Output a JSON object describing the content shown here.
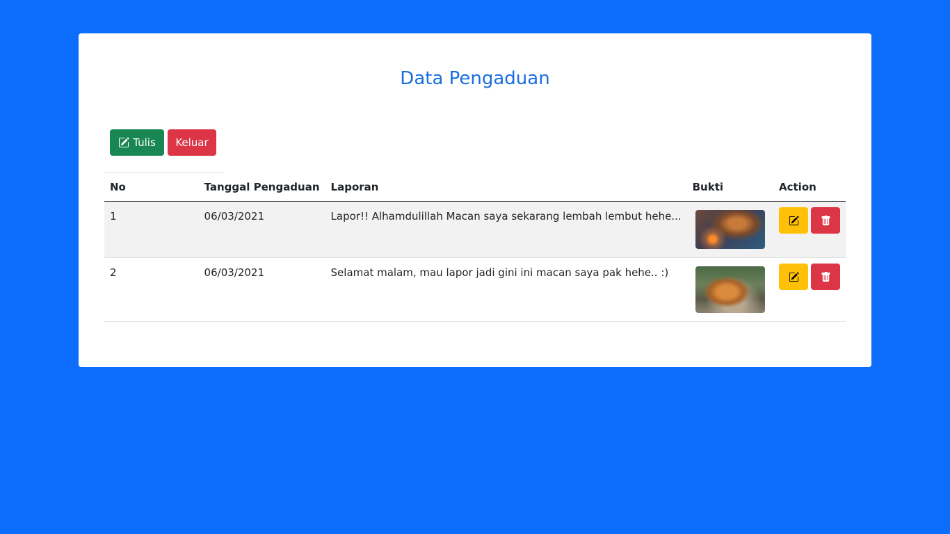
{
  "page": {
    "title": "Data Pengaduan"
  },
  "toolbar": {
    "write_label": "Tulis",
    "logout_label": "Keluar"
  },
  "table": {
    "headers": [
      "No",
      "Tanggal Pengaduan",
      "Laporan",
      "Bukti",
      "Action"
    ],
    "rows": [
      {
        "no": "1",
        "tanggal": "06/03/2021",
        "laporan": "Lapor!! Alhamdulillah Macan saya sekarang lembah lembut hehe...",
        "bukti": "tiger-photo"
      },
      {
        "no": "2",
        "tanggal": "06/03/2021",
        "laporan": "Selamat malam, mau lapor jadi gini ini macan saya pak hehe.. :)",
        "bukti": "tiger-photo"
      }
    ]
  },
  "colors": {
    "background": "#0d6efd",
    "title": "#1a6ee0",
    "success": "#198754",
    "danger": "#dc3545",
    "warning": "#ffc107"
  },
  "icons": {
    "write": "pencil-square-icon",
    "edit": "pencil-square-icon",
    "delete": "trash-icon"
  }
}
